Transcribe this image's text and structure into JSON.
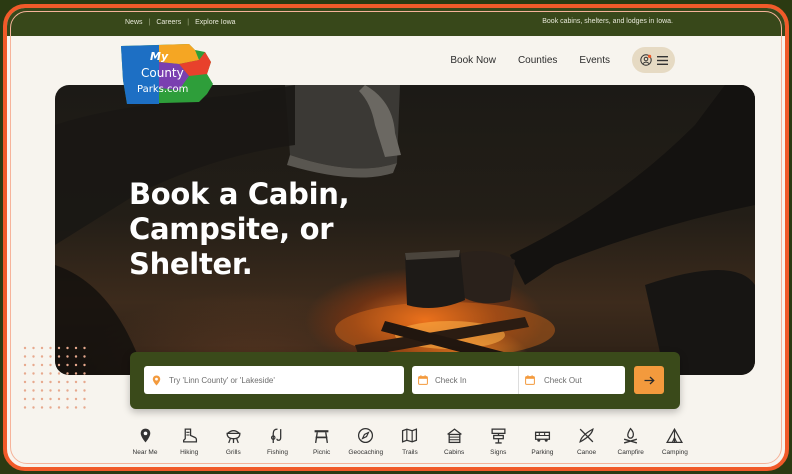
{
  "topbar": {
    "links": [
      "News",
      "Careers",
      "Explore Iowa"
    ],
    "tagline": "Book cabins, shelters, and lodges in Iowa."
  },
  "logo": {
    "line1": "My",
    "line2": "County",
    "line3": "Parks.com"
  },
  "nav": {
    "items": [
      "Book Now",
      "Counties",
      "Events"
    ]
  },
  "hero": {
    "line1": "Book a Cabin,",
    "line2": "Campsite, or",
    "line3": "Shelter."
  },
  "search": {
    "where_placeholder": "Try 'Linn County' or 'Lakeside'",
    "checkin_placeholder": "Check In",
    "checkout_placeholder": "Check Out"
  },
  "categories": [
    {
      "label": "Near Me",
      "icon": "pin-icon"
    },
    {
      "label": "Hiking",
      "icon": "boot-icon"
    },
    {
      "label": "Grills",
      "icon": "grill-icon"
    },
    {
      "label": "Fishing",
      "icon": "fishing-icon"
    },
    {
      "label": "Picnic",
      "icon": "picnic-table-icon"
    },
    {
      "label": "Geocaching",
      "icon": "compass-icon"
    },
    {
      "label": "Trails",
      "icon": "map-icon"
    },
    {
      "label": "Cabins",
      "icon": "cabin-icon"
    },
    {
      "label": "Signs",
      "icon": "sign-icon"
    },
    {
      "label": "Parking",
      "icon": "car-icon"
    },
    {
      "label": "Canoe",
      "icon": "canoe-icon"
    },
    {
      "label": "Campfire",
      "icon": "campfire-icon"
    },
    {
      "label": "Camping",
      "icon": "tent-icon"
    }
  ],
  "colors": {
    "accent": "#f39a3d",
    "brand_green": "#38481a",
    "frame": "#f15a29"
  }
}
